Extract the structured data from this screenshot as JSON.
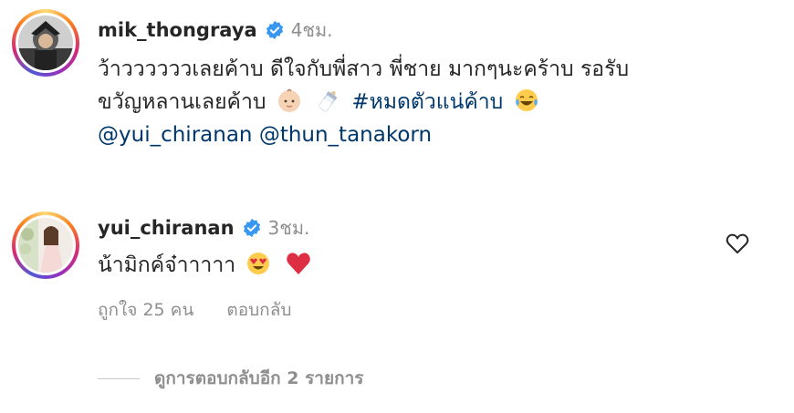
{
  "post": {
    "username": "mik_thongraya",
    "time": "4ชม.",
    "caption_line1": "ว้าววววววเลยค้าบ  ดีใจกับพี่สาว  พี่ชาย  มากๆนะคร้าบ  รอรับ",
    "caption_line2_text": "ขวัญหลานเลยค้าบ",
    "caption_line2_hashtag": "#หมดตัวแน่ค้าบ",
    "mention_1": "@yui_chiranan",
    "mention_2": "@thun_tanakorn",
    "emojis": [
      "baby-face-emoji",
      "baby-bottle-emoji",
      "tears-of-joy-emoji"
    ]
  },
  "comment": {
    "username": "yui_chiranan",
    "time": "3ชม.",
    "text": "น้ามิกค์จ๋าาาาา",
    "emojis": [
      "heart-eyes-emoji",
      "red-heart-emoji"
    ],
    "likes_label": "ถูกใจ 25 คน",
    "reply_label": "ตอบกลับ",
    "view_replies_label": "ดูการตอบกลับอีก 2 รายการ"
  },
  "colors": {
    "text": "#262626",
    "muted": "#8e8e8e",
    "link": "#00376b",
    "verified": "#3897f0"
  }
}
